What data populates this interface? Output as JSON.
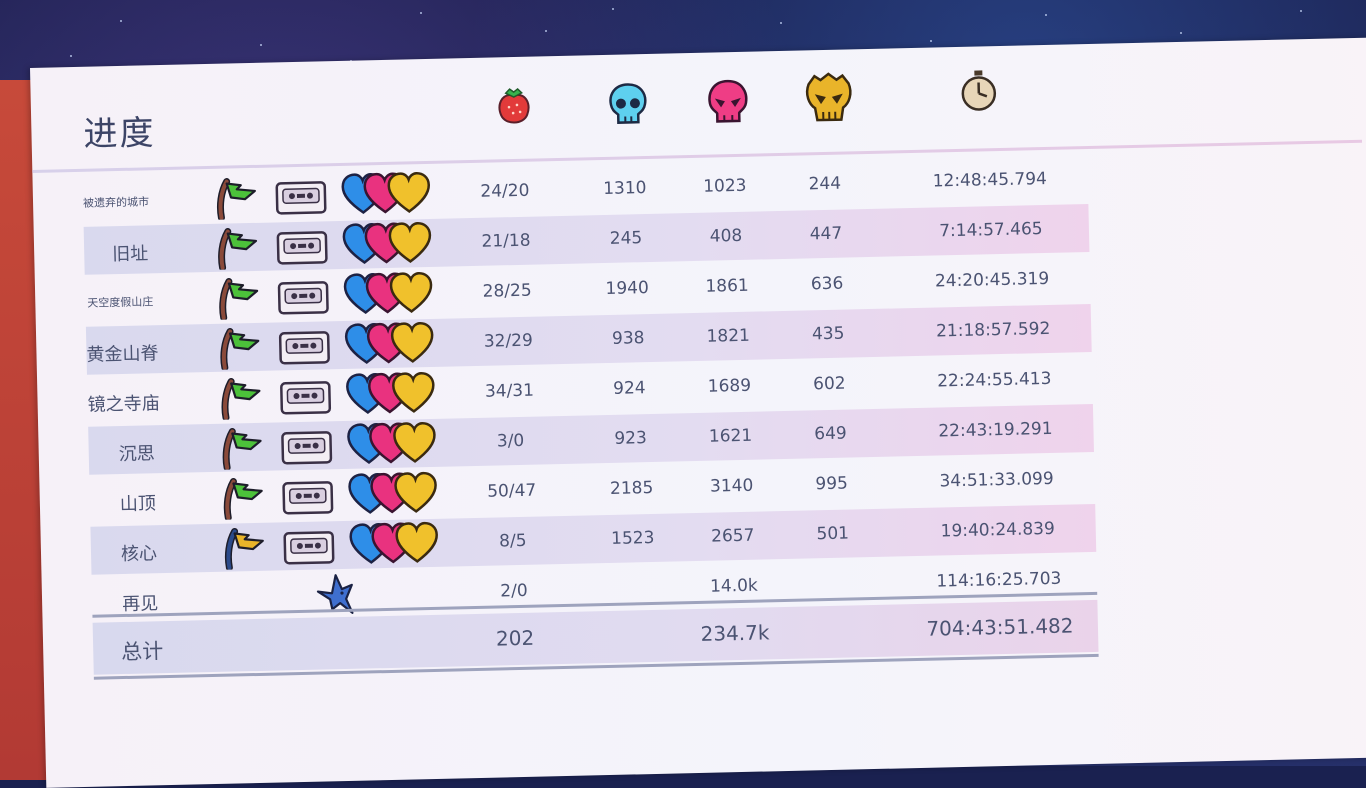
{
  "title": "进度",
  "header_icons": [
    "strawberry-icon",
    "blue-skull-icon",
    "pink-skull-icon",
    "gold-skull-icon",
    "clock-icon"
  ],
  "colors": {
    "strawberry": "#e23a3a",
    "skull_blue": "#5ed0ef",
    "skull_pink": "#ef3d85",
    "skull_gold": "#e9b42a",
    "heart_blue": "#2e8ee8",
    "heart_pink": "#e9327f",
    "heart_gold": "#f0c12c",
    "flag_green": "#4cc13a",
    "flag_gold": "#e9b42a",
    "text": "#4b5372"
  },
  "rows": [
    {
      "name": "被遗弃的城市",
      "strawberries": "24/20",
      "deaths_b": "1310",
      "deaths_c": "1023",
      "deaths_d": "244",
      "time": "12:48:45.794",
      "flag_icon": "green-flag-icon",
      "tape_icon": "cassette-icon",
      "hearts_icon": "three-hearts-icon"
    },
    {
      "name": "旧址",
      "strawberries": "21/18",
      "deaths_b": "245",
      "deaths_c": "408",
      "deaths_d": "447",
      "time": "7:14:57.465",
      "flag_icon": "green-flag-icon",
      "tape_icon": "cassette-icon",
      "hearts_icon": "three-hearts-icon"
    },
    {
      "name": "天空度假山庄",
      "strawberries": "28/25",
      "deaths_b": "1940",
      "deaths_c": "1861",
      "deaths_d": "636",
      "time": "24:20:45.319",
      "flag_icon": "green-flag-icon",
      "tape_icon": "cassette-icon",
      "hearts_icon": "three-hearts-icon"
    },
    {
      "name": "黄金山脊",
      "strawberries": "32/29",
      "deaths_b": "938",
      "deaths_c": "1821",
      "deaths_d": "435",
      "time": "21:18:57.592",
      "flag_icon": "green-flag-icon",
      "tape_icon": "cassette-icon",
      "hearts_icon": "three-hearts-icon"
    },
    {
      "name": "镜之寺庙",
      "strawberries": "34/31",
      "deaths_b": "924",
      "deaths_c": "1689",
      "deaths_d": "602",
      "time": "22:24:55.413",
      "flag_icon": "green-flag-icon",
      "tape_icon": "cassette-icon",
      "hearts_icon": "three-hearts-icon"
    },
    {
      "name": "沉思",
      "strawberries": "3/0",
      "deaths_b": "923",
      "deaths_c": "1621",
      "deaths_d": "649",
      "time": "22:43:19.291",
      "flag_icon": "green-flag-icon",
      "tape_icon": "cassette-icon",
      "hearts_icon": "three-hearts-icon"
    },
    {
      "name": "山顶",
      "strawberries": "50/47",
      "deaths_b": "2185",
      "deaths_c": "3140",
      "deaths_d": "995",
      "time": "34:51:33.099",
      "flag_icon": "green-flag-icon",
      "tape_icon": "cassette-icon",
      "hearts_icon": "three-hearts-icon"
    },
    {
      "name": "核心",
      "strawberries": "8/5",
      "deaths_b": "1523",
      "deaths_c": "2657",
      "deaths_d": "501",
      "time": "19:40:24.839",
      "flag_icon": "gold-flag-icon",
      "tape_icon": "cassette-icon",
      "hearts_icon": "three-hearts-icon"
    },
    {
      "name": "再见",
      "strawberries": "2/0",
      "deaths_c": "14.0k",
      "time": "114:16:25.703",
      "bird_icon": "bird-icon"
    }
  ],
  "totals": {
    "label": "总计",
    "strawberries": "202",
    "deaths": "234.7k",
    "time": "704:43:51.482"
  }
}
